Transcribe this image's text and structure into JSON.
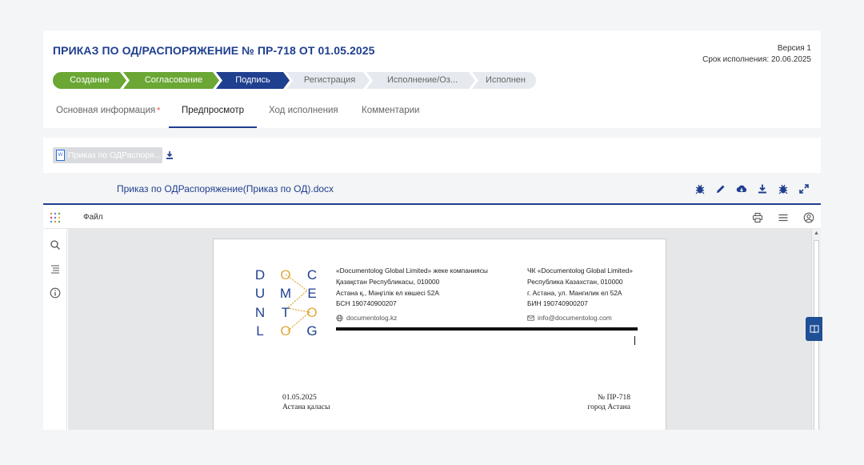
{
  "header": {
    "title": "ПРИКАЗ ПО ОД/РАСПОРЯЖЕНИЕ № ПР-718 ОТ 01.05.2025",
    "version": "Версия 1",
    "deadline": "Срок исполнения: 20.06.2025"
  },
  "stepper": {
    "steps": [
      {
        "label": "Создание",
        "state": "done"
      },
      {
        "label": "Согласование",
        "state": "done"
      },
      {
        "label": "Подпись",
        "state": "active"
      },
      {
        "label": "Регистрация",
        "state": "todo"
      },
      {
        "label": "Исполнение/Оз...",
        "state": "todo"
      },
      {
        "label": "Исполнен",
        "state": "todo"
      }
    ],
    "colors": {
      "done": "#6aa734",
      "active": "#1f3f8f",
      "todo": "#e6e9ef"
    }
  },
  "tabs": [
    {
      "label": "Основная информация",
      "required": "*"
    },
    {
      "label": "Предпросмотр"
    },
    {
      "label": "Ход исполнения"
    },
    {
      "label": "Комментарии"
    }
  ],
  "attachment": {
    "chip_label": "Приказ по ОДРаспоря...",
    "file_name": "Приказ по ОДРаспоряжение(Приказ по ОД).docx",
    "actions": [
      "bug-icon",
      "edit-icon",
      "cloud-download-icon",
      "download-icon",
      "bug-icon",
      "expand-icon"
    ]
  },
  "viewer": {
    "menu_file": "Файл"
  },
  "document": {
    "logo_letters": [
      "D",
      "O",
      "C",
      "U",
      "M",
      "E",
      "N",
      "T",
      "O",
      "L",
      "O",
      "G"
    ],
    "left_block": [
      "«Documentolog Global Limited» жеке компаниясы",
      "Қазақстан Республикасы, 010000",
      "Астана қ., Мәңгілік ел көшесі 52А",
      "БСН 190740900207"
    ],
    "left_contact": "documentolog.kz",
    "right_block": [
      "ЧК «Documentolog Global Limited»",
      "Республика Казахстан, 010000",
      "г. Астана, ул. Мангилик ел 52А",
      "БИН 190740900207"
    ],
    "right_contact": "info@documentolog.com",
    "date": "01.05.2025",
    "city_kz": "Астана қаласы",
    "number": "№ ПР-718",
    "city_ru": "город Астана"
  }
}
